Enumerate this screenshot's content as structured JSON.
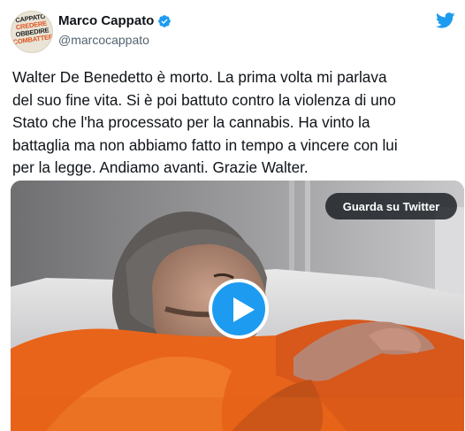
{
  "author": {
    "display_name": "Marco Cappato",
    "handle": "@marcocappato",
    "avatar_text": [
      "CAPPATO",
      "CREDERE",
      "OBBEDIRE",
      "COMBATTERE",
      "·"
    ]
  },
  "tweet": {
    "text": "Walter De Benedetto è morto. La prima volta mi parlava\ndel suo fine vita. Si è poi battuto contro la violenza di uno\nStato che l'ha processato per la cannabis. Ha vinto la\nbattaglia ma non abbiamo fatto in tempo a vincere con lui\nper la legge. Andiamo avanti. Grazie Walter."
  },
  "media": {
    "watch_button_label": "Guarda su Twitter"
  },
  "icons": {
    "verified": "verified-badge-icon",
    "brand": "twitter-bird-icon",
    "play": "play-icon"
  },
  "colors": {
    "accent": "#1d9bf0",
    "text_primary": "#0f1419",
    "text_secondary": "#536471",
    "shirt_orange": "#e8641a"
  }
}
